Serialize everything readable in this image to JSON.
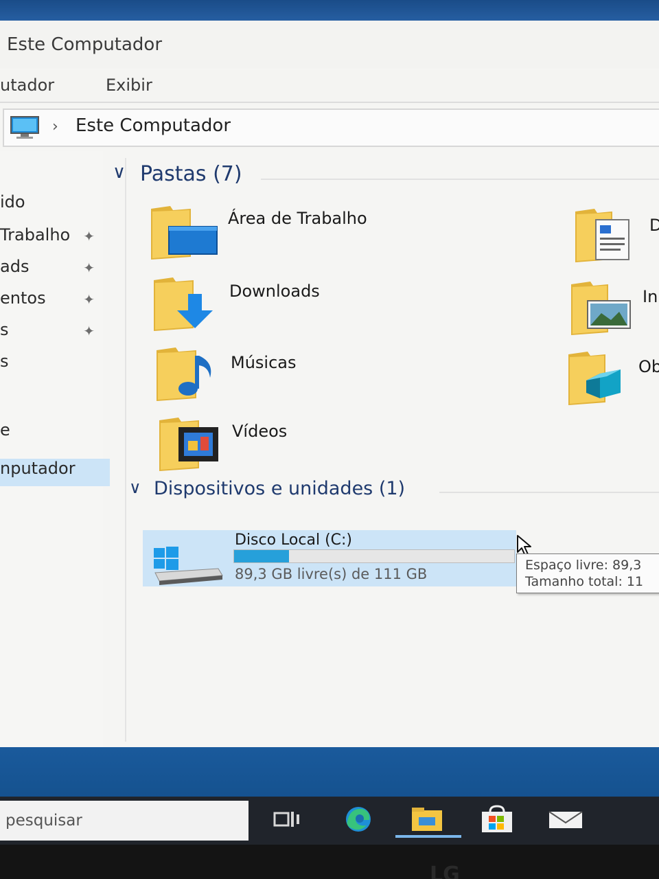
{
  "window": {
    "title": "Este Computador",
    "ribbon_tabs": [
      "utador",
      "Exibir"
    ],
    "address": "Este Computador",
    "address_chevron": "›"
  },
  "nav": {
    "items": [
      {
        "label": "ido",
        "pinned": false
      },
      {
        "label": "Trabalho",
        "pinned": true
      },
      {
        "label": "ads",
        "pinned": true
      },
      {
        "label": "entos",
        "pinned": true
      },
      {
        "label": "s",
        "pinned": true
      },
      {
        "label": "s",
        "pinned": false
      },
      {
        "label": "e",
        "pinned": false
      },
      {
        "label": "nputador",
        "pinned": false,
        "selected": true
      }
    ],
    "pin_glyph": "📌"
  },
  "folders_section": {
    "header": "Pastas (7)",
    "chevron": "∨",
    "items": [
      {
        "label": "Área de Trabalho",
        "icon": "desktop-folder-icon"
      },
      {
        "label": "Downloads",
        "icon": "downloads-folder-icon"
      },
      {
        "label": "Músicas",
        "icon": "music-folder-icon"
      },
      {
        "label": "Vídeos",
        "icon": "videos-folder-icon"
      }
    ],
    "right_column": [
      {
        "label": "D",
        "icon": "documents-folder-icon"
      },
      {
        "label": "In",
        "icon": "pictures-folder-icon"
      },
      {
        "label": "Ob",
        "icon": "3d-objects-folder-icon"
      }
    ]
  },
  "devices_section": {
    "header": "Dispositivos e unidades (1)",
    "chevron": "∨",
    "drive": {
      "name": "Disco Local (C:)",
      "space_text": "89,3 GB livre(s) de 111 GB",
      "used_fraction": 0.196,
      "icon": "windows-drive-icon"
    }
  },
  "tooltip": {
    "line1": "Espaço livre: 89,3",
    "line2": "Tamanho total: 11"
  },
  "taskbar": {
    "search_placeholder": "pesquisar",
    "icons": [
      "task-view-icon",
      "edge-icon",
      "file-explorer-icon",
      "store-icon",
      "mail-icon"
    ]
  },
  "monitor_brand": "LG",
  "colors": {
    "accent": "#26a0da",
    "selection": "#cce4f7",
    "folder": "#f4c542",
    "desktop": "#1a5a9c"
  }
}
